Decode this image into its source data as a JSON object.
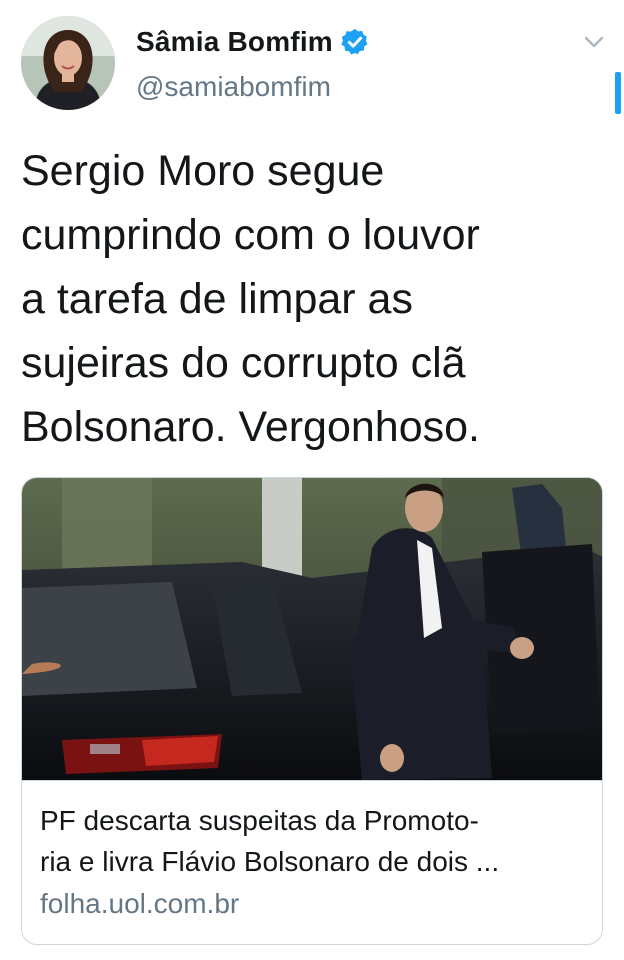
{
  "author": {
    "display_name": "Sâmia Bomfim",
    "handle": "@samiabomfim",
    "verified": true
  },
  "tweet": {
    "text": "Sergio Moro segue\ncumprindo com o louvor\na tarefa de limpar as\nsujeiras do corrupto clã\nBolsonaro. Vergonhoso."
  },
  "link_card": {
    "title": "PF descarta suspeitas da Promoto-\nria e livra Flávio Bolsonaro de dois ...",
    "domain": "folha.uol.com.br",
    "image_description_icon": "photo-man-exiting-car"
  },
  "icons": {
    "verified": "verified-badge-icon",
    "menu": "chevron-down-icon"
  },
  "colors": {
    "accent": "#1da1f2",
    "text_primary": "#14171a",
    "text_secondary": "#657786",
    "border": "#ccd6dd"
  }
}
